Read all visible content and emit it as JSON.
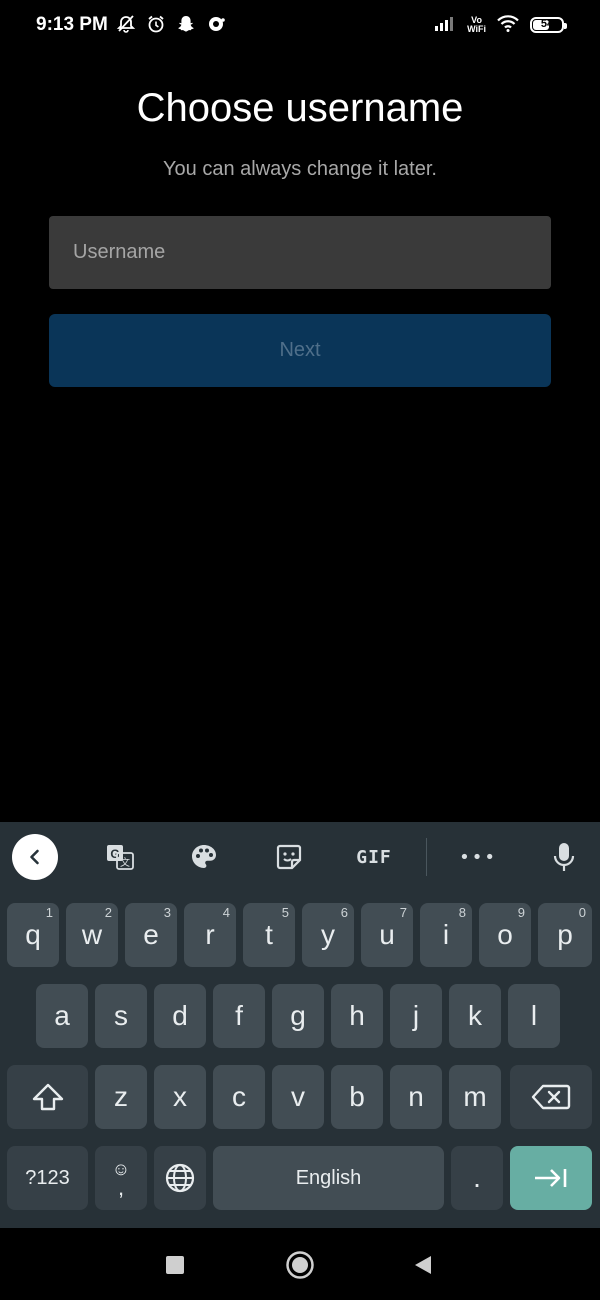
{
  "status_bar": {
    "time": "9:13 PM",
    "left_icons": [
      "mute-bell-icon",
      "alarm-clock-icon",
      "snapchat-icon",
      "messenger-icon"
    ],
    "vowifi_top": "Vo",
    "vowifi_bottom": "WiFi",
    "battery_level": "54",
    "battery_fraction": 0.54
  },
  "main": {
    "title": "Choose username",
    "subtitle": "You can always change it later.",
    "username_placeholder": "Username",
    "username_value": "",
    "next_label": "Next"
  },
  "keyboard": {
    "toolbar_icons": [
      "back-icon",
      "translate-icon",
      "palette-icon",
      "sticker-icon",
      "gif-icon",
      "more-icon",
      "mic-icon"
    ],
    "gif_label": "GIF",
    "more_label": "•••",
    "row1": [
      {
        "key": "q",
        "hint": "1"
      },
      {
        "key": "w",
        "hint": "2"
      },
      {
        "key": "e",
        "hint": "3"
      },
      {
        "key": "r",
        "hint": "4"
      },
      {
        "key": "t",
        "hint": "5"
      },
      {
        "key": "y",
        "hint": "6"
      },
      {
        "key": "u",
        "hint": "7"
      },
      {
        "key": "i",
        "hint": "8"
      },
      {
        "key": "o",
        "hint": "9"
      },
      {
        "key": "p",
        "hint": "0"
      }
    ],
    "row2": [
      "a",
      "s",
      "d",
      "f",
      "g",
      "h",
      "j",
      "k",
      "l"
    ],
    "row3": [
      "z",
      "x",
      "c",
      "v",
      "b",
      "n",
      "m"
    ],
    "symbols_label": "?123",
    "emoji_glyph": "☺",
    "comma_label": ",",
    "space_label": "English",
    "period_label": "."
  },
  "colors": {
    "accent_button": "#0a3558",
    "keyboard_bg": "#273137",
    "enter_key": "#67aea3"
  }
}
